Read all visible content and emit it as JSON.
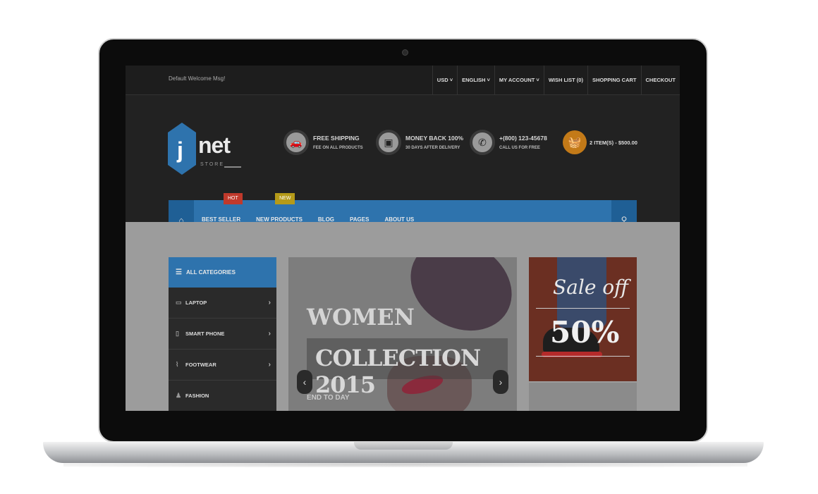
{
  "topbar": {
    "welcome": "Default Welcome Msg!",
    "links": [
      "USD ˅",
      "ENGLISH ˅",
      "MY ACCOUNT ˅",
      "WISH LIST (0)",
      "SHOPPING CART",
      "CHECKOUT"
    ]
  },
  "logo": {
    "main": "net",
    "letter": "j",
    "sub": "STORE"
  },
  "features": [
    {
      "icon": "car-icon",
      "title": "FREE SHIPPING",
      "subtitle": "FEE ON ALL PRODUCTS"
    },
    {
      "icon": "money-icon",
      "title": "MONEY BACK 100%",
      "subtitle": "30 DAYS AFTER DELIVERY"
    },
    {
      "icon": "phone-icon",
      "title": "+(800) 123-45678",
      "subtitle": "CALL US FOR FREE"
    }
  ],
  "cart": {
    "icon": "basket-icon",
    "label": "2 ITEM(S) - $500.00"
  },
  "nav": {
    "items": [
      {
        "label": "BEST SELLER",
        "badge": "HOT"
      },
      {
        "label": "NEW PRODUCTS",
        "badge": "NEW"
      },
      {
        "label": "BLOG"
      },
      {
        "label": "PAGES"
      },
      {
        "label": "ABOUT US"
      }
    ]
  },
  "sidebar": {
    "title": "ALL CATEGORIES",
    "items": [
      {
        "label": "LAPTOP",
        "icon": "laptop-icon",
        "has_sub": true
      },
      {
        "label": "SMART PHONE",
        "icon": "smartphone-icon",
        "has_sub": true
      },
      {
        "label": "FOOTWEAR",
        "icon": "footwear-icon",
        "has_sub": true
      },
      {
        "label": "FASHION",
        "icon": "dress-icon",
        "has_sub": false
      }
    ]
  },
  "slider": {
    "line1": "WOMEN",
    "line2": "COLLECTION 2015",
    "line3": "END TO DAY",
    "prev": "‹",
    "next": "›"
  },
  "promo": {
    "line1": "Sale off",
    "line2": "50%"
  },
  "colors": {
    "accent": "#2e73ad",
    "accent_dark": "#1f5f95",
    "hot": "#c0392b",
    "new": "#b59a18",
    "cart": "#c37a18"
  }
}
